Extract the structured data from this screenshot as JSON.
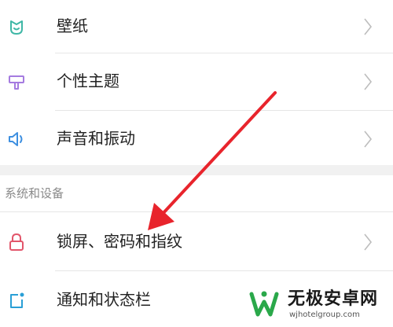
{
  "settings": {
    "items_top": [
      {
        "label": "壁纸",
        "icon": "wallpaper-icon"
      },
      {
        "label": "个性主题",
        "icon": "theme-brush-icon"
      },
      {
        "label": "声音和振动",
        "icon": "speaker-icon"
      }
    ],
    "section_title": "系统和设备",
    "items_bottom": [
      {
        "label": "锁屏、密码和指纹",
        "icon": "lock-icon"
      },
      {
        "label": "通知和状态栏",
        "icon": "notification-icon"
      }
    ]
  },
  "watermark": {
    "title": "无极安卓网",
    "url": "wjhotelgroup.com"
  },
  "colors": {
    "wallpaper_icon": "#3fb7a6",
    "theme_icon": "#a57be0",
    "speaker_icon": "#3d8fe0",
    "lock_icon": "#e2566b",
    "notification_icon": "#2a9fd6",
    "arrow": "#e8242c",
    "logo_green": "#2aa84a"
  }
}
